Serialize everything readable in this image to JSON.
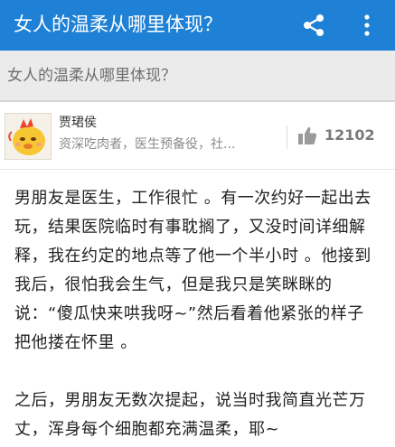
{
  "app_bar": {
    "title": "女人的温柔从哪里体现？",
    "share_icon": "share-icon",
    "more_icon": "more-vertical-icon",
    "color": "#1F81D6"
  },
  "question": {
    "title": "女人的温柔从哪里体现？"
  },
  "author": {
    "avatar_icon": "cartoon-chick-avatar",
    "name": "贾珺侯",
    "bio": "资深吃肉者，医生预备役，社...",
    "vote_icon": "thumbs-up-icon",
    "votes": "12102"
  },
  "answer": {
    "paragraphs": [
      "男朋友是医生，工作很忙 。有一次约好一起出去玩，结果医院临时有事耽搁了，又没时间详细解释，我在约定的地点等了他一个半小时 。他接到我后，很怕我会生气，但是我只是笑眯眯的说：“傻瓜快来哄我呀~”然后看着他紧张的样子把他搂在怀里 。",
      "之后，男朋友无数次提起，说当时我简直光芒万丈，浑身每个细胞都充满温柔，耶~"
    ]
  }
}
